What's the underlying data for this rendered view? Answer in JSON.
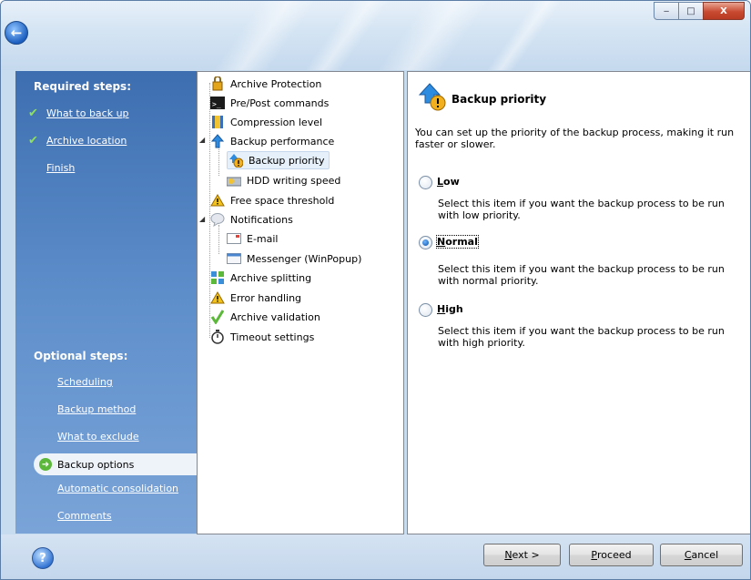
{
  "window": {
    "minimize": "‒",
    "maximize": "□",
    "close": "X",
    "back_glyph": "←"
  },
  "left": {
    "required_header": "Required steps:",
    "required_steps": [
      {
        "label": "What to back up",
        "done": true
      },
      {
        "label": "Archive location",
        "done": true
      },
      {
        "label": "Finish",
        "done": false
      }
    ],
    "optional_header": "Optional steps:",
    "optional_steps": [
      "Scheduling",
      "Backup method",
      "What to exclude"
    ],
    "selected_step": "Backup options",
    "optional_steps_after": [
      "Automatic consolidation",
      "Comments"
    ],
    "check_glyph": "✔",
    "selected_icon": "➜"
  },
  "tree": [
    {
      "label": "Archive Protection",
      "icon": "lock-icon"
    },
    {
      "label": "Pre/Post commands",
      "icon": "console-icon"
    },
    {
      "label": "Compression level",
      "icon": "compression-icon"
    },
    {
      "label": "Backup performance",
      "icon": "up-arrow-icon",
      "expanded": true
    },
    {
      "label": "Backup priority",
      "icon": "priority-icon",
      "selected": true,
      "child": true
    },
    {
      "label": "HDD writing speed",
      "icon": "hdd-icon",
      "child": true
    },
    {
      "label": "Free space threshold",
      "icon": "warning-icon"
    },
    {
      "label": "Notifications",
      "icon": "notification-icon",
      "expanded": true
    },
    {
      "label": "E-mail",
      "icon": "email-icon",
      "child": true
    },
    {
      "label": "Messenger (WinPopup)",
      "icon": "messenger-icon",
      "child": true
    },
    {
      "label": "Archive splitting",
      "icon": "splitting-icon"
    },
    {
      "label": "Error handling",
      "icon": "warning-icon"
    },
    {
      "label": "Archive validation",
      "icon": "validation-icon"
    },
    {
      "label": "Timeout settings",
      "icon": "timer-icon"
    }
  ],
  "panel": {
    "title": "Backup priority",
    "description": "You can set up the priority of the backup process, making it run faster or slower.",
    "options": [
      {
        "label_first": "L",
        "label_rest": "ow",
        "selected": false,
        "description": "Select this item if you want the backup process to be run with low priority."
      },
      {
        "label_first": "N",
        "label_rest": "ormal",
        "selected": true,
        "description": "Select this item if you want the backup process to be run with normal priority."
      },
      {
        "label_first": "H",
        "label_rest": "igh",
        "selected": false,
        "description": "Select this item if you want the backup process to be run with high priority."
      }
    ]
  },
  "footer": {
    "help_glyph": "?",
    "next_first": "N",
    "next_rest": "ext >",
    "proceed_first": "P",
    "proceed_rest": "roceed",
    "cancel_first": "C",
    "cancel_rest": "ancel"
  }
}
